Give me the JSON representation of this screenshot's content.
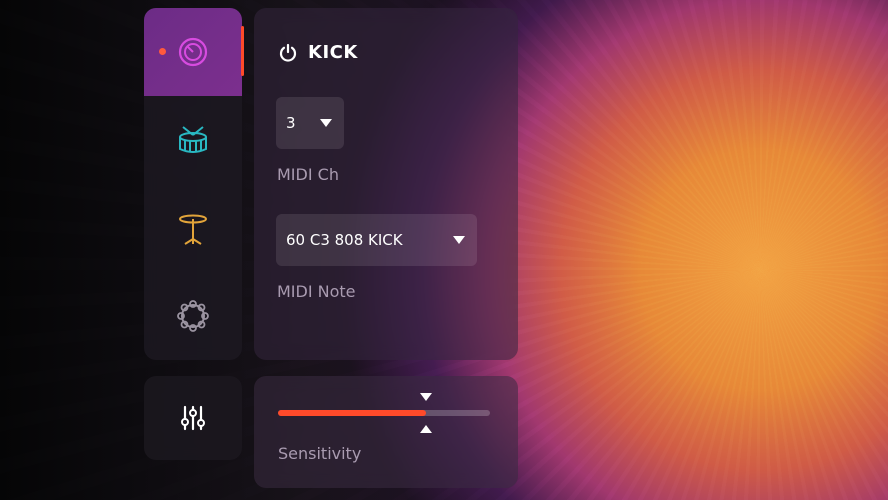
{
  "instrument": {
    "title": "KICK",
    "midi_channel": {
      "value": "3",
      "label": "MIDI Ch"
    },
    "midi_note": {
      "value": "60 C3 808 KICK",
      "label": "MIDI Note"
    }
  },
  "sidebar": {
    "items": [
      {
        "name": "kick",
        "icon": "kick-drum-icon",
        "active": true,
        "color": "#d84be0"
      },
      {
        "name": "snare",
        "icon": "snare-drum-icon",
        "active": false,
        "color": "#29b8c2"
      },
      {
        "name": "cymbal",
        "icon": "cymbal-icon",
        "active": false,
        "color": "#e2a43a"
      },
      {
        "name": "tambourine",
        "icon": "tambourine-icon",
        "active": false,
        "color": "#9a93a0"
      }
    ]
  },
  "mixer": {
    "icon": "sliders-icon"
  },
  "sensitivity": {
    "label": "Sensitivity",
    "value": 0.7
  },
  "colors": {
    "accent": "#ff4a2a",
    "active_tab": "#7c2f8e"
  }
}
